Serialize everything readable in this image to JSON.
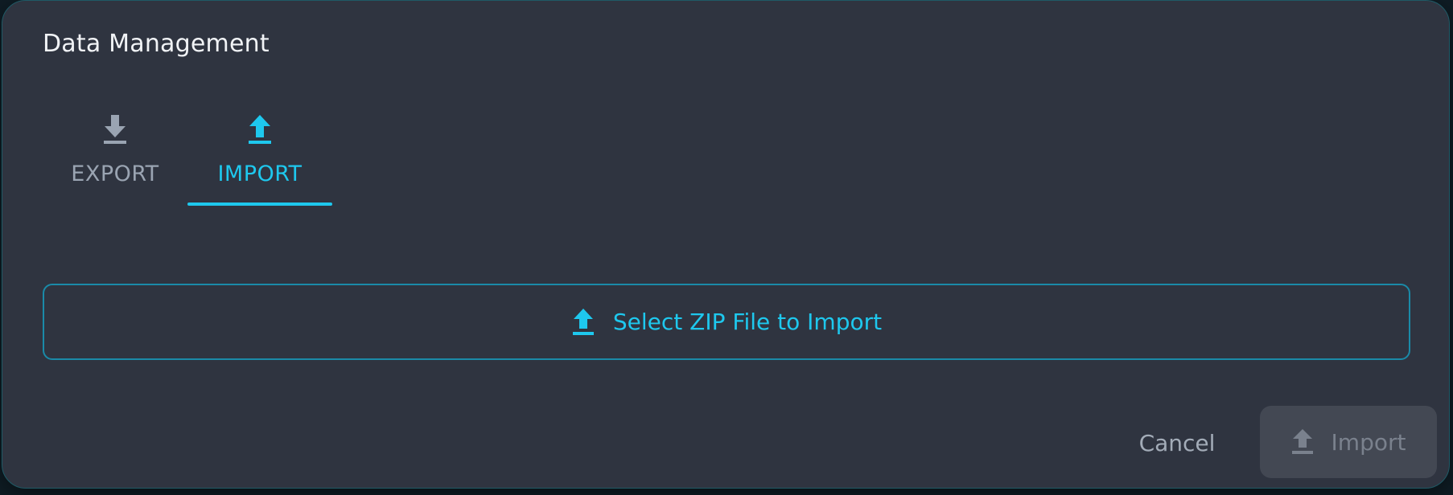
{
  "dialog": {
    "title": "Data Management"
  },
  "tabs": [
    {
      "label": "EXPORT",
      "icon": "download-icon",
      "active": false
    },
    {
      "label": "IMPORT",
      "icon": "upload-icon",
      "active": true
    }
  ],
  "import_panel": {
    "select_button_label": "Select ZIP File to Import",
    "select_button_icon": "upload-icon"
  },
  "footer": {
    "cancel_label": "Cancel",
    "import_label": "Import",
    "import_icon": "upload-icon",
    "import_disabled": true
  },
  "colors": {
    "accent": "#1ec8ee",
    "dialog_background": "#2f3440",
    "inactive_text": "#9aa4b2",
    "disabled_button": "#434853"
  }
}
